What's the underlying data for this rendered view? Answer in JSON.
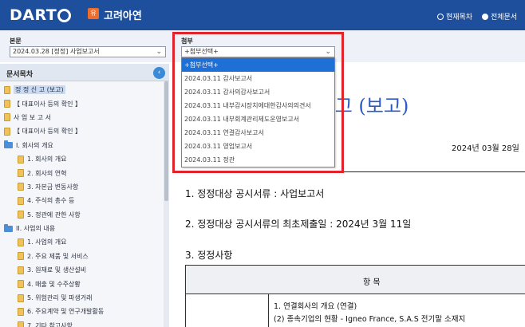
{
  "header": {
    "logo": "DART",
    "company_icon": "유",
    "company": "고려아연",
    "radio_current": "현재목차",
    "radio_full": "전체문서"
  },
  "main_select": {
    "label": "본문",
    "value": "2024.03.28 [정정] 사업보고서"
  },
  "attach_select": {
    "label": "첨부",
    "value": "+첨부선택+",
    "options": [
      "+첨부선택+",
      "2024.03.11   감사보고서",
      "2024.03.11   감사의감사보고서",
      "2024.03.11   내부감시장치에대한감사의의견서",
      "2024.03.11   내부회계관리제도운영보고서",
      "2024.03.11   연결감사보고서",
      "2024.03.11   영업보고서",
      "2024.03.11   정관"
    ]
  },
  "sidebar": {
    "title": "문서목차",
    "toggle": "‹",
    "items": [
      {
        "label": "정 정 신 고 (보고)",
        "icon": "doc-icon",
        "indent": 0,
        "selected": true
      },
      {
        "label": "【 대표이사 등의 확인 】",
        "icon": "doc-icon",
        "indent": 0
      },
      {
        "label": "사 업 보 고 서",
        "icon": "doc-icon",
        "indent": 0
      },
      {
        "label": "【 대표이사 등의 확인 】",
        "icon": "doc-icon",
        "indent": 0
      },
      {
        "label": "I. 회사의 개요",
        "icon": "folder-icon",
        "indent": 0
      },
      {
        "label": "1. 회사의 개요",
        "icon": "doc-icon",
        "indent": 1
      },
      {
        "label": "2. 회사의 연혁",
        "icon": "doc-icon",
        "indent": 1
      },
      {
        "label": "3. 자본금 변동사항",
        "icon": "doc-icon",
        "indent": 1
      },
      {
        "label": "4. 주식의 총수 등",
        "icon": "doc-icon",
        "indent": 1
      },
      {
        "label": "5. 정관에 관한 사항",
        "icon": "doc-icon",
        "indent": 1
      },
      {
        "label": "II. 사업의 내용",
        "icon": "folder-icon",
        "indent": 0
      },
      {
        "label": "1. 사업의 개요",
        "icon": "doc-icon",
        "indent": 1
      },
      {
        "label": "2. 주요 제품 및 서비스",
        "icon": "doc-icon",
        "indent": 1
      },
      {
        "label": "3. 원재료 및 생산설비",
        "icon": "doc-icon",
        "indent": 1
      },
      {
        "label": "4. 매출 및 수주상황",
        "icon": "doc-icon",
        "indent": 1
      },
      {
        "label": "5. 위험관리 및 파생거래",
        "icon": "doc-icon",
        "indent": 1
      },
      {
        "label": "6. 주요계약 및 연구개발활동",
        "icon": "doc-icon",
        "indent": 1
      },
      {
        "label": "7. 기타 참고사항",
        "icon": "doc-icon",
        "indent": 1
      }
    ]
  },
  "document": {
    "title": "신 고 (보고)",
    "date": "2024년 03월 28일",
    "line1": "1. 정정대상 공시서류 : 사업보고서",
    "line2": "2. 정정대상 공시서류의 최초제출일 : 2024년 3월 11일",
    "line3": "3. 정정사항",
    "table_header": "항 목",
    "cell1": "1. 연결회사의 개요 (연결)",
    "cell2": "(2) 종속기업의 현황 - Igneo France, S.A.S 전기말 소재지"
  },
  "colors": {
    "header_bg": "#1d4f9c",
    "highlight_frame": "#e1242b",
    "doc_title": "#2a5bc4",
    "dropdown_selected": "#1e6fd6"
  }
}
